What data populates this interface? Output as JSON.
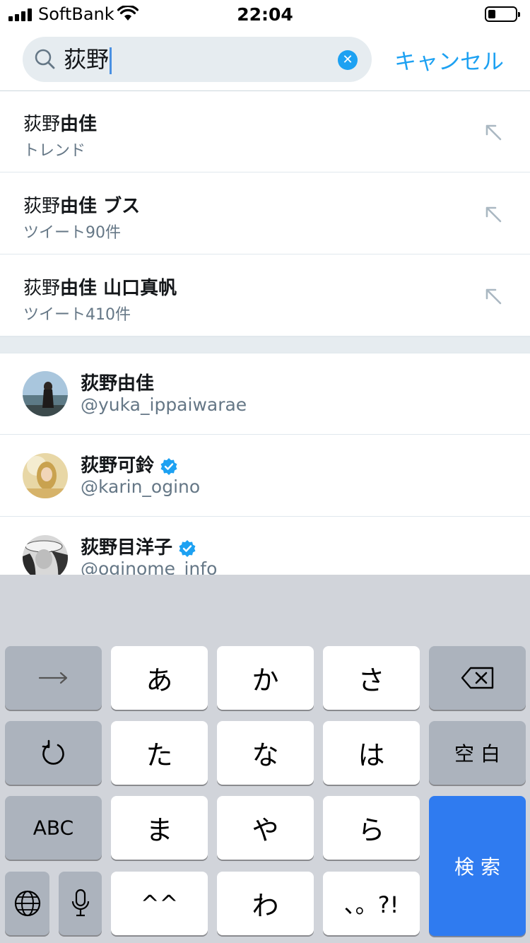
{
  "status_bar": {
    "carrier": "SoftBank",
    "time": "22:04"
  },
  "search": {
    "query": "荻野",
    "cancel_label": "キャンセル"
  },
  "suggestions": [
    {
      "plain": "荻野",
      "bold": "由佳",
      "sub": "トレンド"
    },
    {
      "plain": "荻野",
      "bold": "由佳 ブス",
      "sub": "ツイート90件"
    },
    {
      "plain": "荻野",
      "bold": "由佳 山口真帆",
      "sub": "ツイート410件"
    }
  ],
  "users": [
    {
      "name": "荻野由佳",
      "handle": "@yuka_ippaiwarae",
      "verified": false
    },
    {
      "name": "荻野可鈴",
      "handle": "@karin_ogino",
      "verified": true
    },
    {
      "name": "荻野目洋子",
      "handle": "@oginome_info",
      "verified": true
    }
  ],
  "keyboard": {
    "keys": {
      "a": "あ",
      "ka": "か",
      "sa": "さ",
      "ta": "た",
      "na": "な",
      "ha": "は",
      "space": "空 白",
      "abc": "ABC",
      "ma": "ま",
      "ya": "や",
      "ra": "ら",
      "search": "検 索",
      "kaomoji": "^^",
      "wa": "わ",
      "punct": "、。?!"
    }
  },
  "colors": {
    "accent": "#1da1f2",
    "search_key": "#2f7bf0"
  },
  "icons": {
    "search": "search-icon",
    "clear": "clear-icon",
    "arrow": "arrow-up-left-icon",
    "verified": "verified-badge-icon",
    "backspace": "backspace-icon",
    "next": "arrow-right-icon",
    "undo": "undo-icon",
    "globe": "globe-icon",
    "mic": "microphone-icon"
  }
}
